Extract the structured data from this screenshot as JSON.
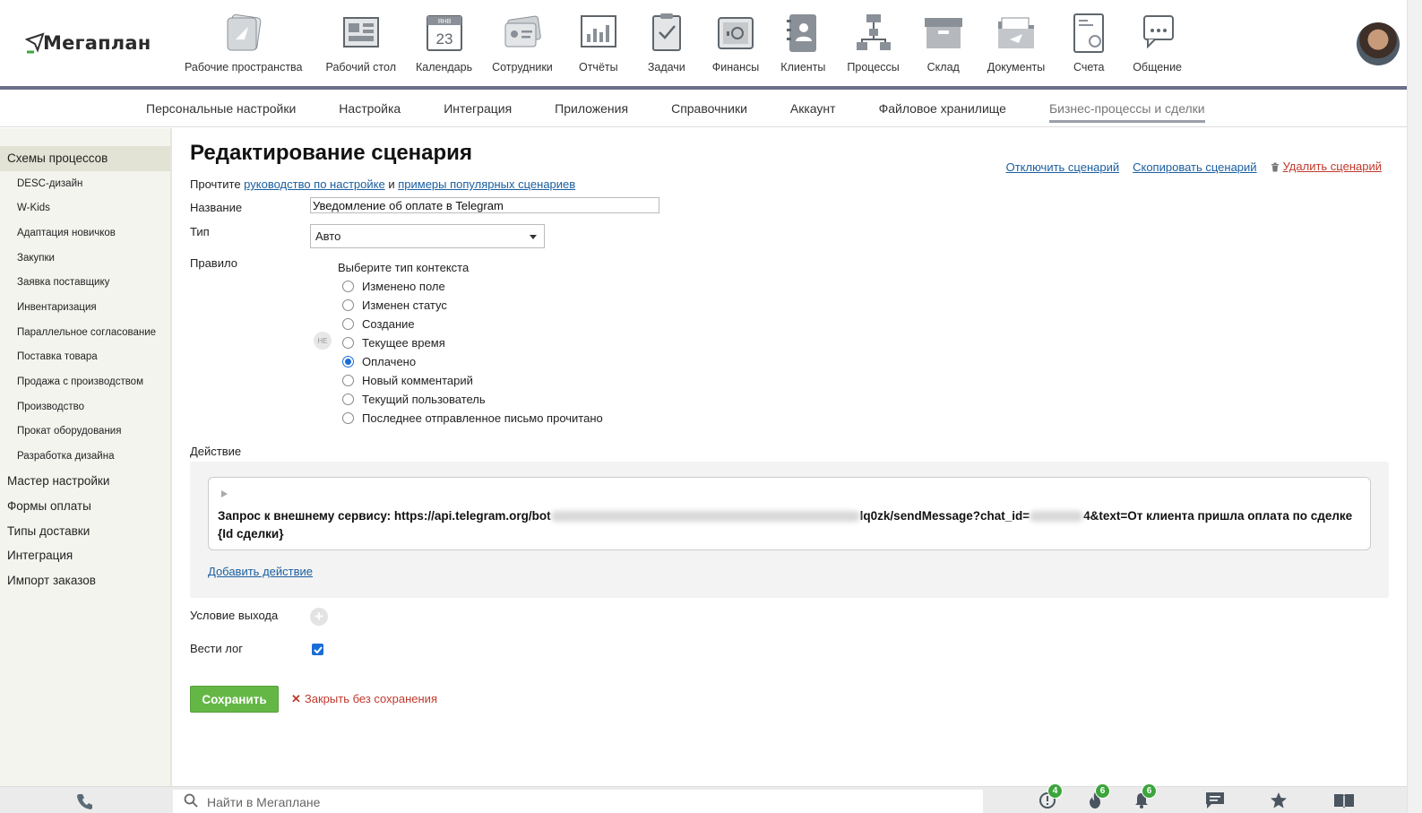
{
  "app": {
    "logo_text": "Мегаплан",
    "modules": [
      {
        "label": "Рабочие пространства",
        "icon": "workspaces-icon"
      },
      {
        "label": "Рабочий стол",
        "icon": "desktop-icon"
      },
      {
        "label": "Календарь",
        "icon": "calendar-icon",
        "month": "ЯНВ",
        "day": "23"
      },
      {
        "label": "Сотрудники",
        "icon": "employees-icon"
      },
      {
        "label": "Отчёты",
        "icon": "reports-icon"
      },
      {
        "label": "Задачи",
        "icon": "tasks-icon"
      },
      {
        "label": "Финансы",
        "icon": "finance-icon"
      },
      {
        "label": "Клиенты",
        "icon": "clients-icon"
      },
      {
        "label": "Процессы",
        "icon": "processes-icon"
      },
      {
        "label": "Склад",
        "icon": "warehouse-icon"
      },
      {
        "label": "Документы",
        "icon": "documents-icon"
      },
      {
        "label": "Счета",
        "icon": "invoices-icon"
      },
      {
        "label": "Общение",
        "icon": "chat-icon"
      }
    ]
  },
  "subnav": {
    "items": [
      "Персональные настройки",
      "Настройка",
      "Интеграция",
      "Приложения",
      "Справочники",
      "Аккаунт",
      "Файловое хранилище",
      "Бизнес-процессы и сделки"
    ],
    "active_index": 7
  },
  "sidebar": {
    "items": [
      {
        "label": "Схемы процессов",
        "type": "top",
        "active": true
      },
      {
        "label": "DESC-дизайн",
        "type": "sub"
      },
      {
        "label": "W-Kids",
        "type": "sub"
      },
      {
        "label": "Адаптация новичков",
        "type": "sub"
      },
      {
        "label": "Закупки",
        "type": "sub"
      },
      {
        "label": "Заявка поставщику",
        "type": "sub"
      },
      {
        "label": "Инвентаризация",
        "type": "sub"
      },
      {
        "label": "Параллельное согласование",
        "type": "sub"
      },
      {
        "label": "Поставка товара",
        "type": "sub"
      },
      {
        "label": "Продажа с производством",
        "type": "sub"
      },
      {
        "label": "Производство",
        "type": "sub"
      },
      {
        "label": "Прокат оборудования",
        "type": "sub"
      },
      {
        "label": "Разработка дизайна",
        "type": "sub"
      },
      {
        "label": "Мастер настройки",
        "type": "top"
      },
      {
        "label": "Формы оплаты",
        "type": "top"
      },
      {
        "label": "Типы доставки",
        "type": "top"
      },
      {
        "label": "Интеграция",
        "type": "top"
      },
      {
        "label": "Импорт заказов",
        "type": "top"
      }
    ]
  },
  "page": {
    "title": "Редактирование сценария",
    "actions": {
      "disable": "Отключить сценарий",
      "copy": "Скопировать сценарий",
      "delete": "Удалить сценарий"
    },
    "read_prefix": "Прочтите",
    "guide_link": "руководство по настройке",
    "and": "и",
    "examples_link": "примеры популярных сценариев",
    "labels": {
      "name": "Название",
      "type": "Тип",
      "rule": "Правило",
      "action": "Действие",
      "exit_condition": "Условие выхода",
      "log": "Вести лог"
    },
    "name_value": "Уведомление об оплате в Telegram",
    "type_value": "Авто",
    "context_title": "Выберите тип контекста",
    "ne_badge": "НЕ",
    "context_options": [
      "Изменено поле",
      "Изменен статус",
      "Создание",
      "Текущее время",
      "Оплачено",
      "Новый комментарий",
      "Текущий пользователь",
      "Последнее отправленное письмо прочитано"
    ],
    "selected_context_index": 4,
    "action_text_part1": "Запрос к внешнему сервису: https://api.telegram.org/bot",
    "action_text_part2": "lq0zk/sendMessage?chat_id=",
    "action_text_part3": "4&text=От клиента пришла оплата по сделке {Id сделки}",
    "add_action": "Добавить действие",
    "log_checked": true,
    "save": "Сохранить",
    "close": "Закрыть без сохранения"
  },
  "bottombar": {
    "search_placeholder": "Найти в Мегаплане",
    "badges": {
      "alerts": "4",
      "hot": "6",
      "notifications": "6"
    }
  },
  "colors": {
    "accent_green": "#64b745",
    "link": "#1a5fa0",
    "danger": "#c0392b",
    "badge_green": "#3ca53c",
    "topbar_line": "#6b6f88"
  }
}
